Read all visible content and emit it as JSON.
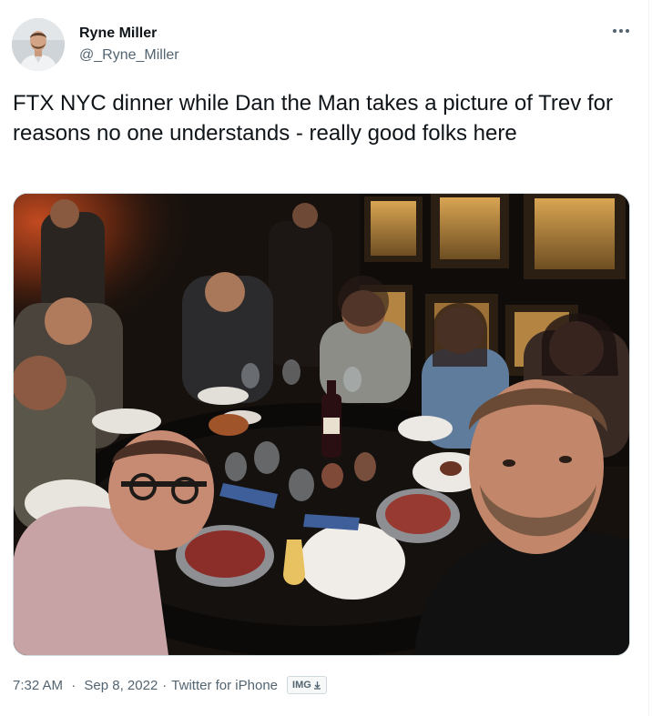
{
  "author": {
    "name": "Ryne Miller",
    "handle": "@_Ryne_Miller"
  },
  "tweet": {
    "text": "FTX NYC dinner while Dan the Man takes a picture of Trev for reasons no one understands - really good folks here",
    "time": "7:32 AM",
    "date": "Sep 8, 2022",
    "source": "Twitter for iPhone",
    "separator": "·"
  },
  "badge": {
    "label": "IMG",
    "icon": "download-icon"
  },
  "icons": {
    "more": "more-horizontal-icon"
  },
  "colors": {
    "text": "#0f1419",
    "secondary": "#536471",
    "border": "#cfd9de"
  }
}
